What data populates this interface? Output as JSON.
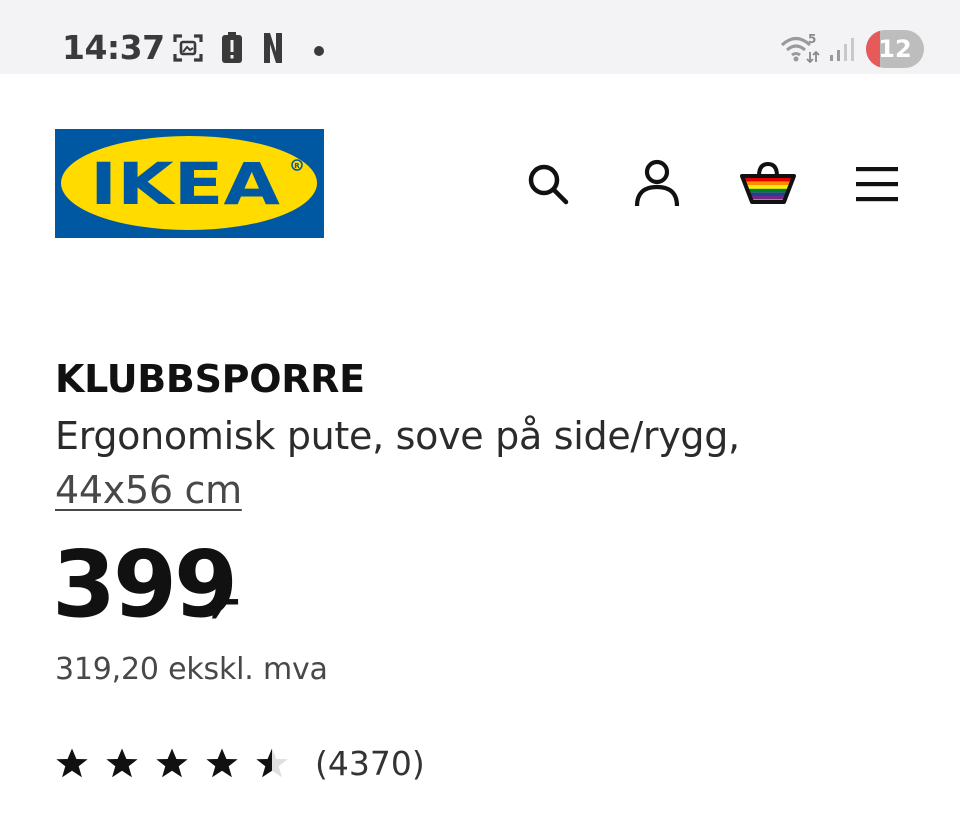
{
  "status_bar": {
    "time": "14:37",
    "battery": "12",
    "icons": [
      "screenshot-icon",
      "battery-alert-icon",
      "netflix-icon",
      "dot-icon",
      "wifi-icon",
      "signal-icon"
    ]
  },
  "header": {
    "logo_text": "IKEA",
    "icons": [
      "search-icon",
      "account-icon",
      "shopping-bag-icon",
      "menu-icon"
    ]
  },
  "product": {
    "name": "KLUBBSPORRE",
    "description": "Ergonomisk pute, sove på side/rygg,",
    "size": "44x56 cm",
    "price": "399",
    "price_suffix": ",-",
    "price_excl_vat": "319,20 ekskl. mva",
    "rating": 4.5,
    "review_count": "(4370)"
  },
  "colors": {
    "ikea_blue": "#0058a3",
    "ikea_yellow": "#ffdb00",
    "text": "#111111"
  }
}
